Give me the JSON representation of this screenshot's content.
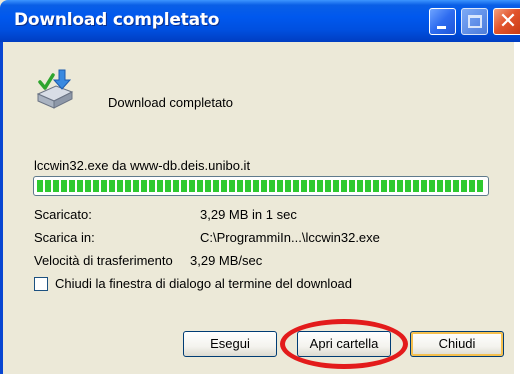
{
  "window": {
    "title": "Download completato",
    "close_glyph": "✕"
  },
  "content": {
    "message": "Download completato",
    "file_source": "lccwin32.exe da www-db.deis.unibo.it",
    "progress_fraction": 1.0,
    "details": [
      {
        "label": "Scaricato:",
        "value": "3,29 MB in 1 sec"
      },
      {
        "label": "Scarica in:",
        "value": "C:\\ProgrammiIn...\\lccwin32.exe"
      },
      {
        "label": "Velocità di trasferimento",
        "value": "3,29 MB/sec"
      }
    ],
    "close_on_complete": {
      "label": "Chiudi la finestra di dialogo al termine del download",
      "checked": false
    }
  },
  "buttons": {
    "run": "Esegui",
    "open_folder": "Apri cartella",
    "close": "Chiudi"
  },
  "icons": {
    "titlebar": [
      "minimize-icon",
      "maximize-icon",
      "close-icon"
    ],
    "main": "download-complete-icon"
  },
  "colors": {
    "titlebar": "#0058ee",
    "progress": "#2fc92f",
    "annotation": "#e31b1b"
  }
}
